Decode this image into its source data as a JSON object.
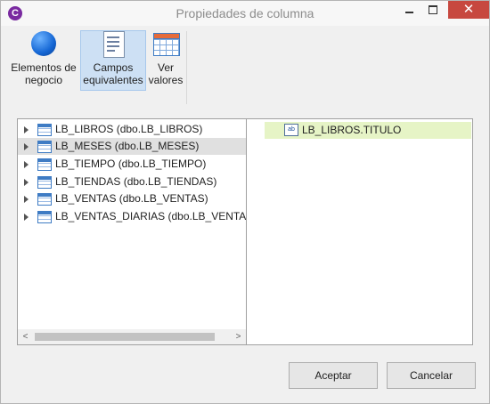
{
  "window": {
    "title": "Propiedades de columna",
    "app_icon": "C",
    "controls": {
      "close": "✕"
    }
  },
  "ribbon": {
    "buttons": [
      {
        "label_line1": "Elementos de",
        "label_line2": "negocio",
        "icon": "blue-sphere-icon",
        "selected": false
      },
      {
        "label_line1": "Campos",
        "label_line2": "equivalentes",
        "icon": "document-list-icon",
        "selected": true
      },
      {
        "label_line1": "Ver",
        "label_line2": "valores",
        "icon": "table-grid-icon",
        "selected": false
      }
    ]
  },
  "tree": {
    "items": [
      {
        "label": "LB_LIBROS (dbo.LB_LIBROS)",
        "selected": false
      },
      {
        "label": "LB_MESES (dbo.LB_MESES)",
        "selected": true
      },
      {
        "label": "LB_TIEMPO (dbo.LB_TIEMPO)",
        "selected": false
      },
      {
        "label": "LB_TIENDAS (dbo.LB_TIENDAS)",
        "selected": false
      },
      {
        "label": "LB_VENTAS (dbo.LB_VENTAS)",
        "selected": false
      },
      {
        "label": "LB_VENTAS_DIARIAS (dbo.LB_VENTAS_D",
        "selected": false
      }
    ],
    "scroll_left": "<",
    "scroll_right": ">"
  },
  "results": {
    "items": [
      {
        "label": "LB_LIBROS.TITULO",
        "icon_text": "ab"
      }
    ]
  },
  "dialog": {
    "ok_label": "Aceptar",
    "cancel_label": "Cancelar"
  },
  "colors": {
    "selection_bg": "#cde0f4",
    "result_highlight": "#e6f4c6",
    "close_button": "#c7483f"
  }
}
